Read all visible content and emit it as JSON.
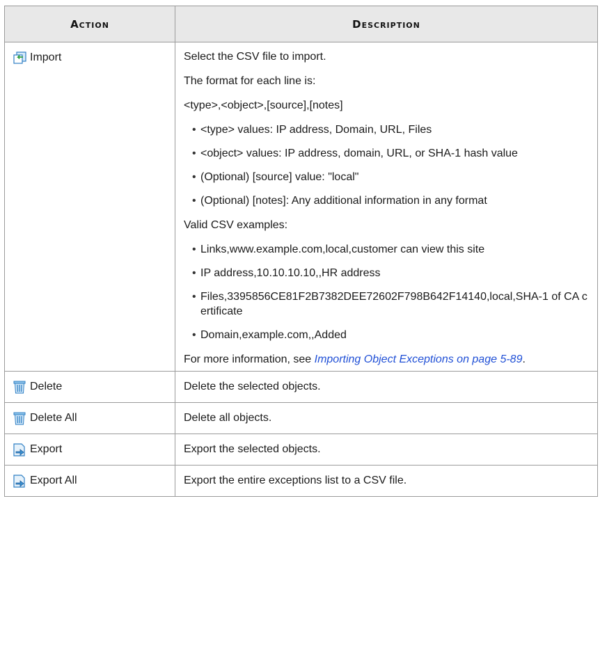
{
  "headers": {
    "action": "Action",
    "description": "Description"
  },
  "import": {
    "label": "Import",
    "icon": "import-icon",
    "lines": {
      "select": "Select the CSV file to import.",
      "format_intro": "The format for each line is:",
      "format": "<type>,<object>,[source],[notes]"
    },
    "format_bullets": [
      "<type> values: IP address, Domain, URL, Files",
      "<object> values: IP address, domain, URL, or SHA-1 hash value",
      "(Optional) [source] value: \"local\"",
      "(Optional) [notes]: Any additional information in any format"
    ],
    "examples_intro": "Valid CSV examples:",
    "examples": [
      "Links,www.example.com,local,customer can view this site",
      "IP address,10.10.10.10,,HR address",
      "Files,3395856CE81F2B7382DEE72602F798B642F14140,local,SHA-1 of CA certificate",
      "Domain,example.com,,Added"
    ],
    "more_prefix": "For more information, see ",
    "more_link": "Importing Object Exceptions on page 5-89",
    "more_suffix": "."
  },
  "rows": [
    {
      "label": "Delete",
      "icon": "trash-icon",
      "desc": "Delete the selected objects."
    },
    {
      "label": "Delete All",
      "icon": "trash-icon",
      "desc": "Delete all objects."
    },
    {
      "label": "Export",
      "icon": "export-icon",
      "desc": "Export the selected objects."
    },
    {
      "label": "Export All",
      "icon": "export-icon",
      "desc": "Export the entire exceptions list to a CSV file."
    }
  ],
  "colors": {
    "header_bg": "#e8e8e8",
    "link": "#1f4fd6",
    "border": "#9a9a9a"
  }
}
